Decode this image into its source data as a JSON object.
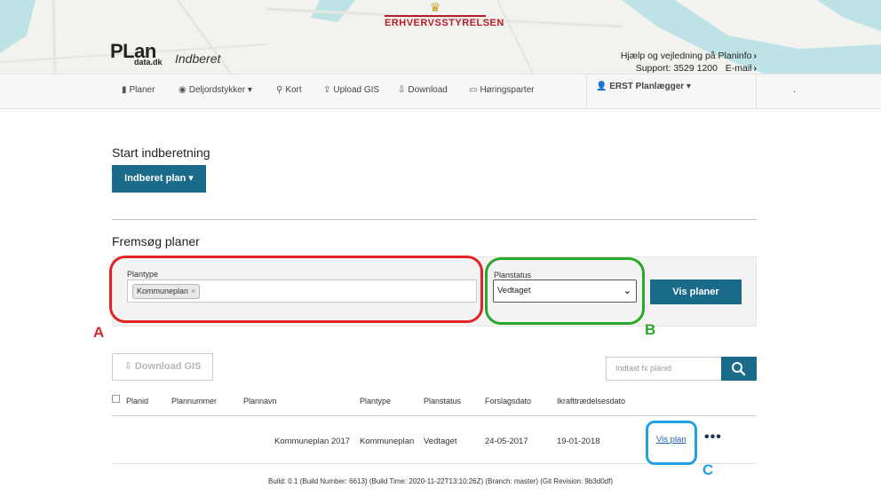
{
  "header": {
    "logo_main": "PLan",
    "logo_sub": "data.dk",
    "app_name": "Indberet",
    "agency_name": "ERHVERVSSTYRELSEN",
    "help_text": "Hjælp og vejledning på Planinfo",
    "support_text": "Support: 3529 1200",
    "email_text": "E-mail"
  },
  "nav": {
    "items": [
      {
        "label": "Planer",
        "icon": "file-icon"
      },
      {
        "label": "Deljordstykker",
        "icon": "globe-icon",
        "dropdown": true
      },
      {
        "label": "Kort",
        "icon": "map-marker-icon"
      },
      {
        "label": "Upload GIS",
        "icon": "upload-icon"
      },
      {
        "label": "Download",
        "icon": "download-icon"
      },
      {
        "label": "Høringsparter",
        "icon": "contacts-icon"
      }
    ],
    "user": "ERST Planlægger"
  },
  "start": {
    "heading": "Start indberetning",
    "button": "Indberet plan"
  },
  "search": {
    "heading": "Fremsøg planer",
    "plantype_label": "Plantype",
    "plantype_tag": "Kommuneplan",
    "planstatus_label": "Planstatus",
    "planstatus_value": "Vedtaget",
    "submit": "Vis planer"
  },
  "annotations": {
    "a": "A",
    "b": "B",
    "c": "C"
  },
  "toolbar": {
    "download_gis": "Download GIS",
    "search_placeholder": "Indtast fx planid"
  },
  "table": {
    "headers": [
      "Planid",
      "Plannummer",
      "Plannavn",
      "Plantype",
      "Planstatus",
      "Forslagsdato",
      "Ikrafttrædelsesdato"
    ],
    "rows": [
      {
        "planid": "",
        "plannummer": "",
        "plannavn": "Kommuneplan 2017",
        "plantype": "Kommuneplan",
        "planstatus": "Vedtaget",
        "forslagsdato": "24-05-2017",
        "ikraft": "19-01-2018",
        "link": "Vis plan"
      }
    ]
  },
  "footer": "Build: 0.1 (Build Number: 6613) (Build Time: 2020-11-22T13:10:26Z) (Branch: master) (Git Revision: 9b3d0df)",
  "colors": {
    "primary": "#1a6a8a",
    "annotation_a": "#e02424",
    "annotation_b": "#2aa62a",
    "annotation_c": "#22a0e0"
  }
}
